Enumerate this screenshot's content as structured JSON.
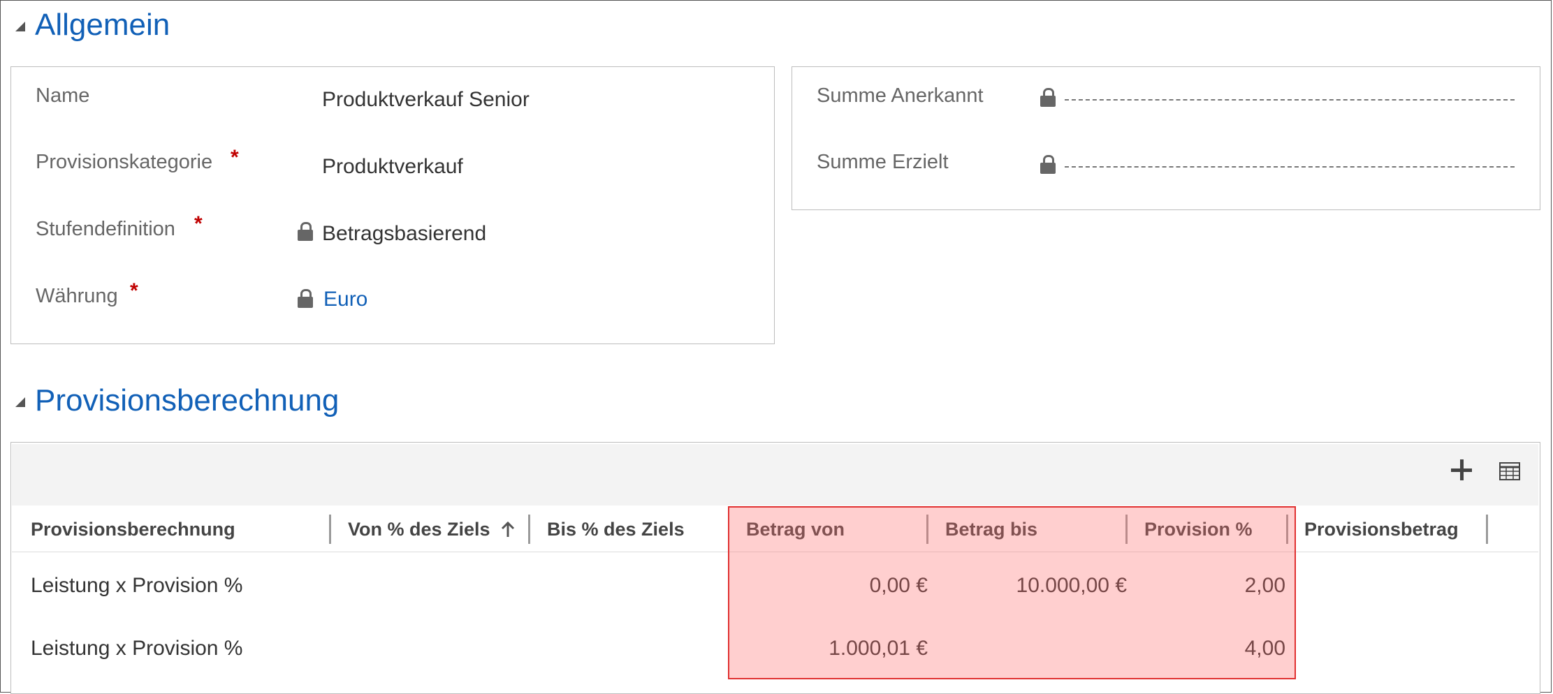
{
  "sections": {
    "general": {
      "title": "Allgemein"
    },
    "calc": {
      "title": "Provisionsberechnung"
    }
  },
  "general_fields": {
    "name": {
      "label": "Name",
      "value": "Produktverkauf Senior"
    },
    "category": {
      "label": "Provisionskategorie",
      "required": "*",
      "value": "Produktverkauf"
    },
    "tier_definition": {
      "label": "Stufendefinition",
      "required": "*",
      "value": "Betragsbasierend",
      "locked": true
    },
    "currency": {
      "label": "Währung",
      "required": "*",
      "value": "Euro",
      "locked": true
    }
  },
  "summary_fields": {
    "recognized": {
      "label": "Summe Anerkannt",
      "locked": true
    },
    "achieved": {
      "label": "Summe Erzielt",
      "locked": true
    }
  },
  "grid": {
    "toolbar": {
      "add_icon": "plus-icon",
      "view_icon": "grid-view-icon"
    },
    "columns": [
      {
        "label": "Provisionsberechnung"
      },
      {
        "label": "Von % des Ziels",
        "sort": "ascending"
      },
      {
        "label": "Bis % des Ziels"
      },
      {
        "label": "Betrag von"
      },
      {
        "label": "Betrag bis"
      },
      {
        "label": "Provision %"
      },
      {
        "label": "Provisionsbetrag"
      }
    ],
    "rows": [
      {
        "calc": "Leistung x Provision %",
        "amount_from": "0,00 €",
        "amount_to": "10.000,00 €",
        "percent": "2,00"
      },
      {
        "calc": "Leistung x Provision %",
        "amount_from": "1.000,01 €",
        "amount_to": "",
        "percent": "4,00"
      }
    ]
  },
  "colors": {
    "accent": "#1160b7",
    "required": "#c00000",
    "highlight_fill": "#ffcfcf",
    "highlight_border": "#e03030"
  }
}
